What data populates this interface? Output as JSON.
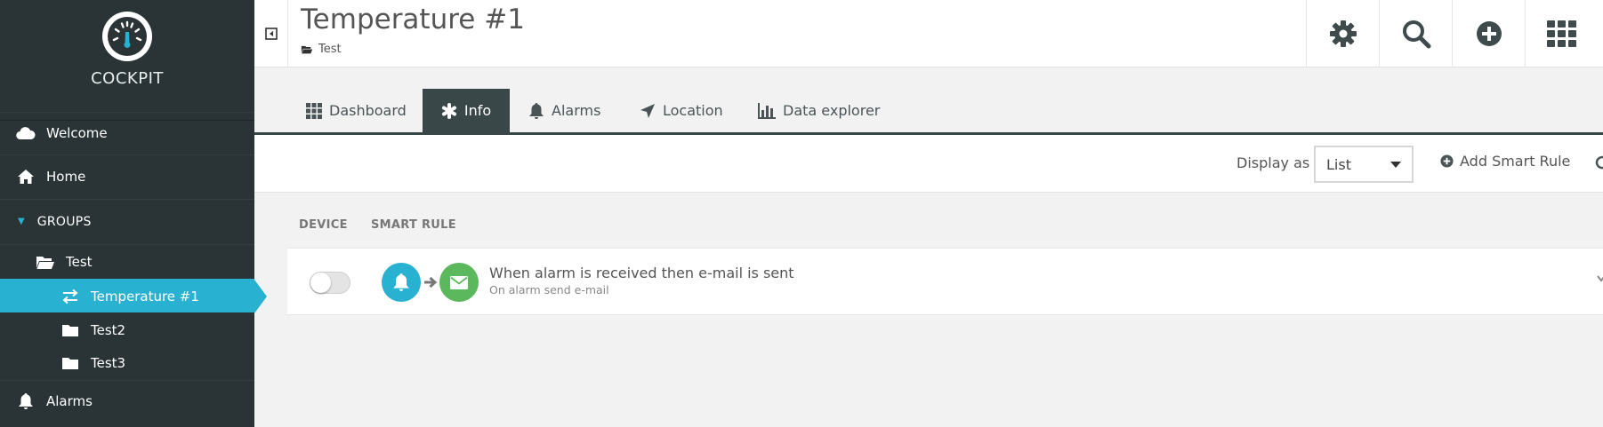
{
  "brand": {
    "name": "COCKPIT"
  },
  "sidebar": {
    "items": [
      {
        "label": "Welcome",
        "icon": "cloud-icon"
      },
      {
        "label": "Home",
        "icon": "home-icon"
      },
      {
        "label": "GROUPS",
        "icon": "caret-down-icon"
      },
      {
        "label": "Test",
        "icon": "folder-open-icon"
      },
      {
        "label": "Temperature #1",
        "icon": "exchange-icon",
        "active": true
      },
      {
        "label": "Test2",
        "icon": "folder-icon"
      },
      {
        "label": "Test3",
        "icon": "folder-icon"
      },
      {
        "label": "Alarms",
        "icon": "bell-icon"
      }
    ]
  },
  "header": {
    "title": "Temperature #1",
    "breadcrumb": "Test",
    "actions": [
      "settings-gear-icon",
      "search-icon",
      "add-circle-icon",
      "app-grid-icon"
    ]
  },
  "tabs": [
    {
      "label": "Dashboard",
      "icon": "grid-icon"
    },
    {
      "label": "Info",
      "icon": "asterisk-icon",
      "active": true
    },
    {
      "label": "Alarms",
      "icon": "bell-icon"
    },
    {
      "label": "Location",
      "icon": "location-arrow-icon"
    },
    {
      "label": "Data explorer",
      "icon": "bar-chart-icon"
    }
  ],
  "toolbar": {
    "display_label": "Display as",
    "display_value": "List",
    "add_rule_label": "Add Smart Rule"
  },
  "table": {
    "columns": [
      "DEVICE",
      "SMART RULE"
    ],
    "rows": [
      {
        "enabled": false,
        "title": "When alarm is received then e-mail is sent",
        "description": "On alarm send e-mail"
      }
    ]
  },
  "colors": {
    "sidebar_bg": "#2a3436",
    "accent": "#29b1d1",
    "tab_active_bg": "#394749",
    "email_green": "#5cb85c"
  }
}
